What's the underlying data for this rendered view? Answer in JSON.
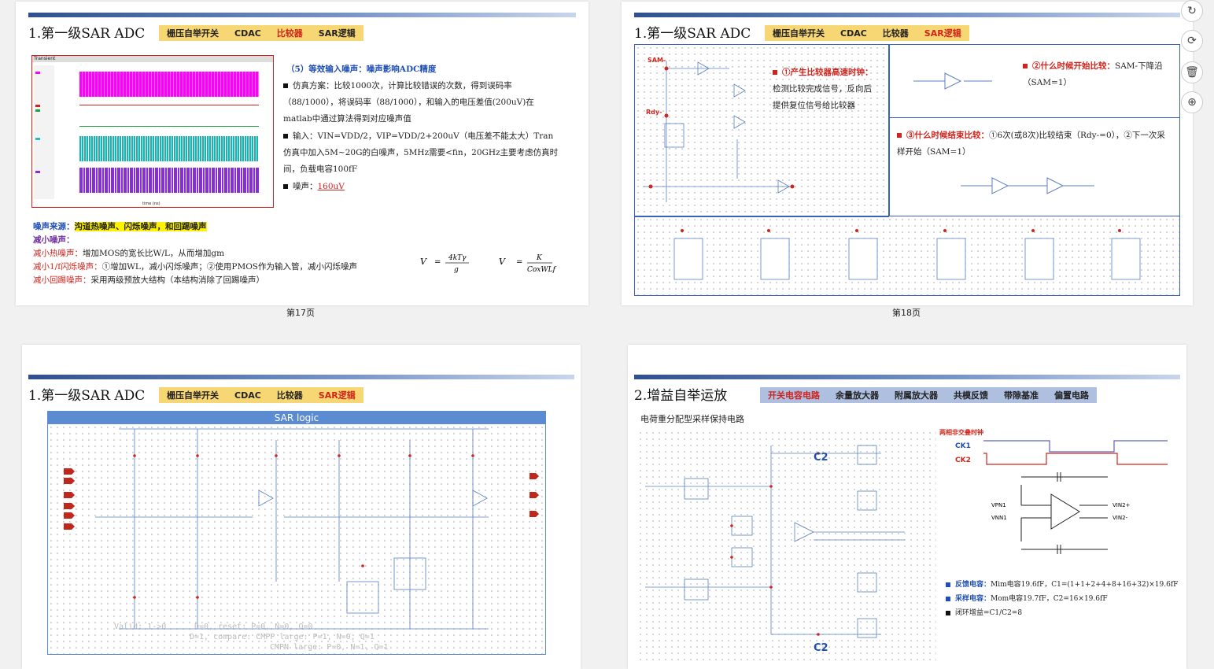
{
  "slides": [
    {
      "title": "1.第一级SAR ADC",
      "tabs": [
        "栅压自举开关",
        "CDAC",
        "比较器",
        "SAR逻辑"
      ],
      "active_tab": 2,
      "caption": "第17页",
      "heading": "（5）等效输入噪声：噪声影响ADC精度",
      "b1": "仿真方案：比较1000次，计算比较错误的次数，得到误码率（88/1000），将误码率（88/1000），和输入的电压差值(200uV)在matlab中通过算法得到对应噪声值",
      "b2": "输入：VIN=VDD/2，VIP=VDD/2+200uV（电压差不能太大）Tran仿真中加入5M~20G的白噪声，5MHz需要<fin，20GHz主要考虑仿真时间，负载电容100fF",
      "b3_label": "噪声：",
      "b3_value": "160uV",
      "src_label": "噪声来源：",
      "src_value": "沟道热噪声、闪烁噪声，和回踢噪声",
      "reduce_title": "减小噪声：",
      "r1_label": "减小热噪声：",
      "r1": "增加MOS的宽长比W/L，从而增加gm",
      "r2_label": "减小1/f闪烁噪声：",
      "r2": "①增加WL，减小闪烁噪声；②使用PMOS作为输入管，减小闪烁噪声",
      "r3_label": "减小回踢噪声：",
      "r3": "采用两级预放大结构（本结构消除了回踢噪声）",
      "plot_title": "Transient",
      "plot_xlabel": "time (ns)"
    },
    {
      "title": "1.第一级SAR ADC",
      "tabs": [
        "栅压自举开关",
        "CDAC",
        "比较器",
        "SAR逻辑"
      ],
      "active_tab": 3,
      "caption": "第18页",
      "p1_title": "①产生比较器高速时钟：",
      "p1_text": "检测比较完成信号，反向后提供复位信号给比较器",
      "p2_title": "②什么时候开始比较：",
      "p2_text": "SAM-下降沿（SAM=1）",
      "p3_title": "③什么时候结束比较：",
      "p3_text": "①6次(或8次)比较结束（Rdy-=0），②下一次采样开始（SAM=1）"
    },
    {
      "title": "1.第一级SAR ADC",
      "tabs": [
        "栅压自举开关",
        "CDAC",
        "比较器",
        "SAR逻辑"
      ],
      "active_tab": 3,
      "box_title": "SAR logic",
      "note1": "Valid: 1->0",
      "note2": "D=0, reset: P=0, N=0, Q=0",
      "note3": "D=1, compare: CMPP large: P=1, N=0, Q=1",
      "note4": "CMPN large: P=0, N=1, Q=1"
    },
    {
      "title": "2.增益自举运放",
      "tabs": [
        "开关电容电路",
        "余量放大器",
        "附属放大器",
        "共模反馈",
        "带隙基准",
        "偏置电路"
      ],
      "active_tab": 0,
      "subtitle": "电荷重分配型采样保持电路",
      "clk_title": "两相非交叠时钟",
      "ck1": "CK1",
      "ck2": "CK2",
      "c2_label": "C2",
      "b1_label": "反馈电容：",
      "b1": "Mim电容19.6fF，C1=(1+1+2+4+8+16+32)×19.6fF",
      "b2_label": "采样电容：",
      "b2": "Mom电容19.7fF，C2=16×19.6fF",
      "b3": "闭环增益=C1/C2=8"
    }
  ],
  "side_buttons": [
    "refresh-icon",
    "rotate-icon",
    "trash-icon",
    "zoom-in-icon"
  ],
  "colors": {
    "tab_bg": "#f7d774",
    "accent_red": "#d0241c",
    "accent_blue": "#1f4fb4",
    "box_blue": "#5b8bd0"
  }
}
